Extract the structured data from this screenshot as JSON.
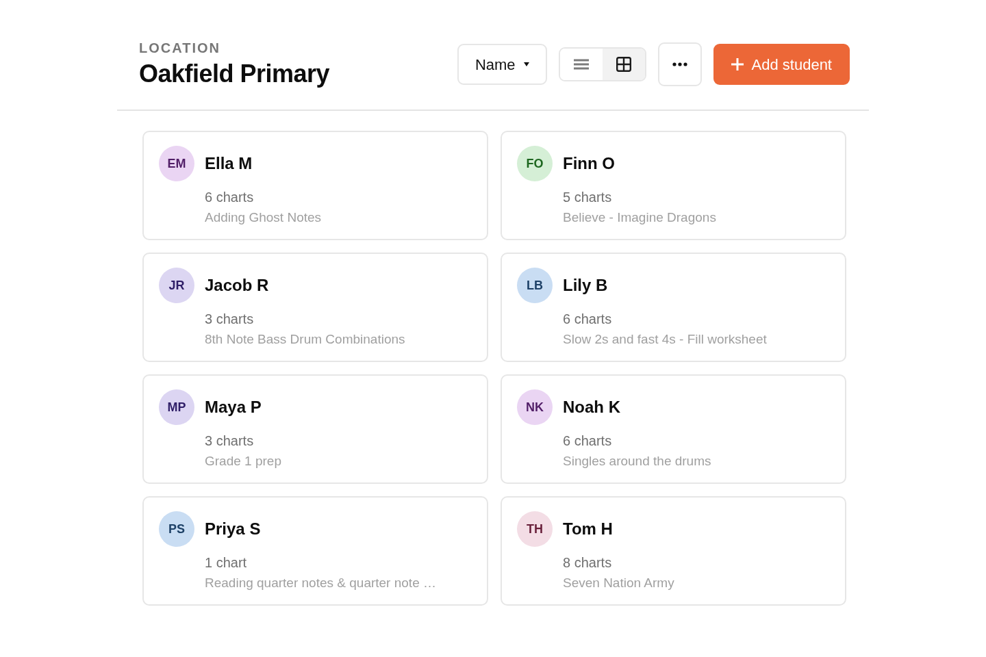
{
  "header": {
    "eyebrow": "LOCATION",
    "title": "Oakfield Primary"
  },
  "toolbar": {
    "sort": {
      "label": "Name"
    },
    "view_modes": [
      {
        "kind": "list",
        "selected": false
      },
      {
        "kind": "grid",
        "selected": true
      }
    ],
    "add_button": {
      "label": "Add student"
    }
  },
  "students": [
    {
      "initials": "EM",
      "name": "Ella M",
      "color": "#ead5f3",
      "charts": "6 charts",
      "subtitle": "Adding Ghost Notes"
    },
    {
      "initials": "FO",
      "name": "Finn O",
      "color": "#d5efd6",
      "charts": "5 charts",
      "subtitle": "Believe - Imagine Dragons"
    },
    {
      "initials": "JR",
      "name": "Jacob R",
      "color": "#dcd6f2",
      "charts": "3 charts",
      "subtitle": "8th Note Bass Drum Combinations"
    },
    {
      "initials": "LB",
      "name": "Lily B",
      "color": "#c9ddf3",
      "charts": "6 charts",
      "subtitle": "Slow 2s and fast 4s - Fill worksheet"
    },
    {
      "initials": "MP",
      "name": "Maya P",
      "color": "#dcd5f2",
      "charts": "3 charts",
      "subtitle": "Grade 1 prep"
    },
    {
      "initials": "NK",
      "name": "Noah K",
      "color": "#ead5f3",
      "charts": "6 charts",
      "subtitle": "Singles around the drums"
    },
    {
      "initials": "PS",
      "name": "Priya S",
      "color": "#c9ddf3",
      "charts": "1 chart",
      "subtitle": "Reading quarter notes & quarter note …"
    },
    {
      "initials": "TH",
      "name": "Tom H",
      "color": "#f3dde5",
      "charts": "8 charts",
      "subtitle": "Seven Nation Army"
    }
  ]
}
